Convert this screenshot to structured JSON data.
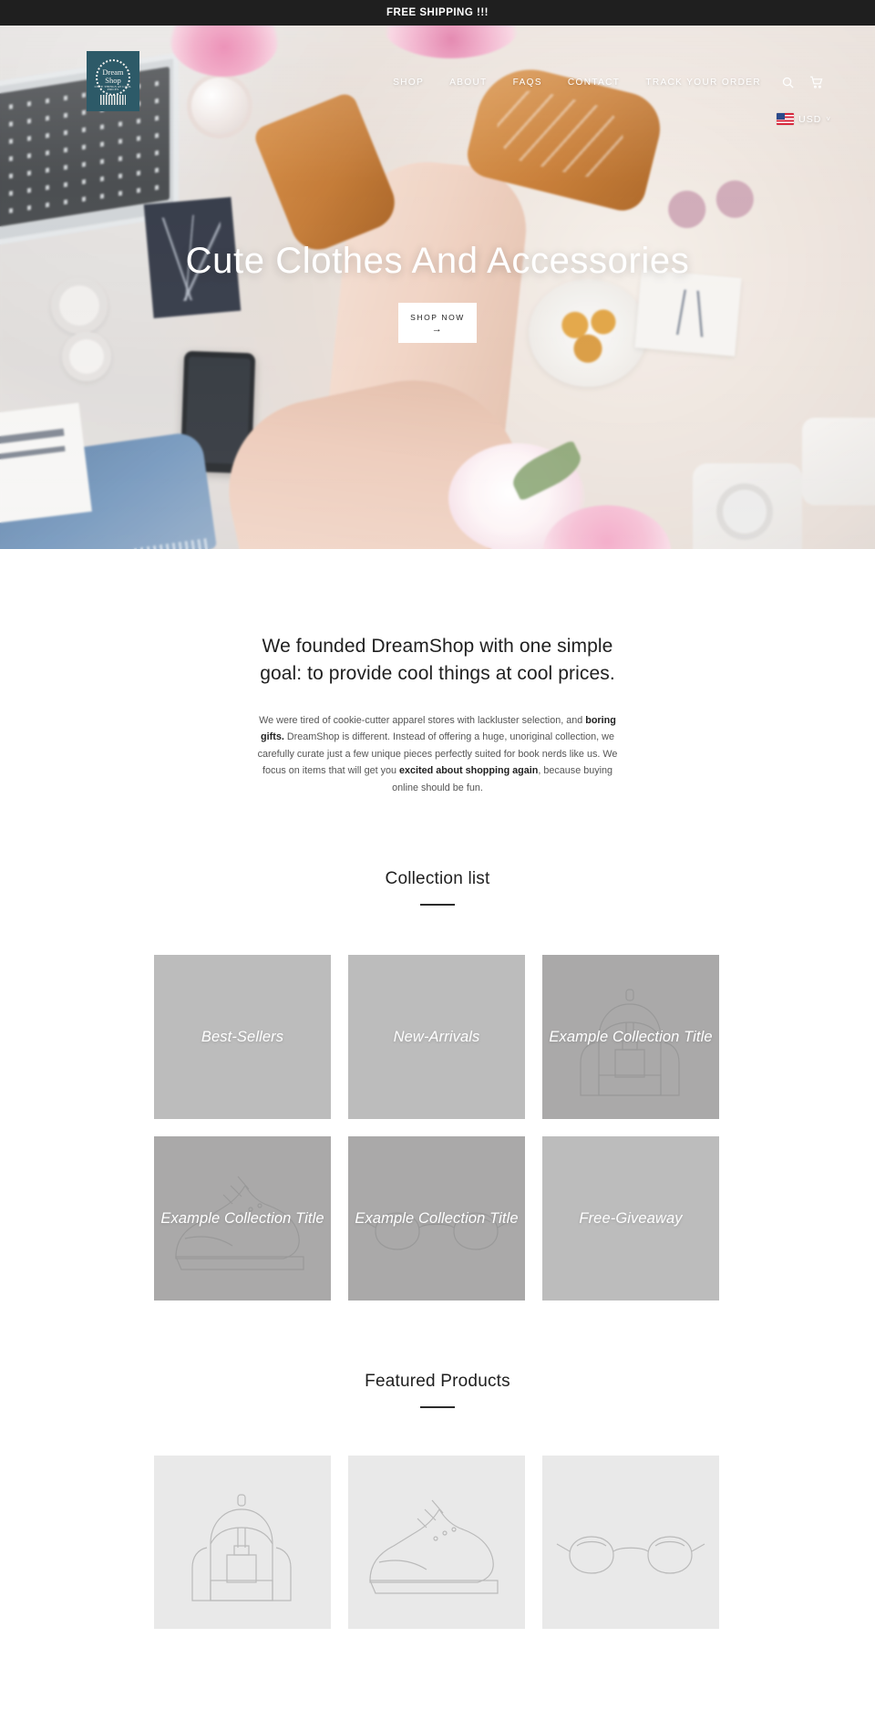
{
  "announcement": {
    "text": "FREE SHIPPING !!!"
  },
  "header": {
    "logo": {
      "line1": "Dream",
      "line2": "Shop",
      "line3": "CUTE THINGS AT COOL PRICES",
      "bg_color": "#2d5a68"
    },
    "nav": [
      {
        "label": "SHOP"
      },
      {
        "label": "ABOUT"
      },
      {
        "label": "FAQS"
      },
      {
        "label": "CONTACT"
      },
      {
        "label": "TRACK YOUR ORDER"
      }
    ],
    "icons": {
      "search": "search-icon",
      "cart": "cart-icon"
    },
    "currency": {
      "code": "USD",
      "flag": "us-flag-icon",
      "chevron": "˅"
    }
  },
  "hero": {
    "title": "Cute Clothes And Accessories",
    "cta": {
      "label": "SHOP NOW",
      "arrow": "→"
    }
  },
  "intro": {
    "heading": "We founded DreamShop with one simple goal: to provide cool things at cool prices.",
    "body_1": "We were tired of cookie-cutter apparel stores with lackluster selection, and ",
    "body_bold_1": "boring gifts.",
    "body_2": " DreamShop is different. Instead of offering a huge, unoriginal collection, we carefully curate just a few unique pieces perfectly suited for book nerds like us. We focus on items that will get you ",
    "body_bold_2": "excited about shopping again",
    "body_3": ", because buying online should be fun."
  },
  "collections": {
    "title": "Collection list",
    "items": [
      {
        "label": "Best-Sellers",
        "art": "none",
        "shade": "light"
      },
      {
        "label": "New-Arrivals",
        "art": "none",
        "shade": "light"
      },
      {
        "label": "Example Collection Title",
        "art": "backpack",
        "shade": "dark"
      },
      {
        "label": "Example Collection Title",
        "art": "shoe",
        "shade": "dark"
      },
      {
        "label": "Example Collection Title",
        "art": "glasses",
        "shade": "dark"
      },
      {
        "label": "Free-Giveaway",
        "art": "none",
        "shade": "light"
      }
    ]
  },
  "featured": {
    "title": "Featured Products",
    "items": [
      {
        "art": "backpack"
      },
      {
        "art": "shoe"
      },
      {
        "art": "glasses"
      }
    ]
  },
  "colors": {
    "announce_bg": "#1f1f1f",
    "tile_light": "#bcbcbc",
    "tile_dark": "#aaa9a9",
    "product_bg": "#e9e9e9"
  }
}
